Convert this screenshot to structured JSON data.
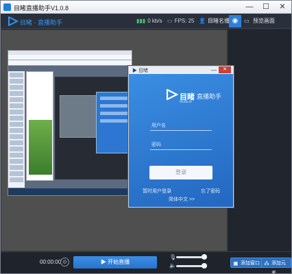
{
  "window": {
    "title": "目睹直播助手V1.0.8",
    "controls": {
      "minimize": "—",
      "maximize": "☐",
      "close": "✕"
    }
  },
  "header": {
    "brand": "目睹 · 直播助手",
    "stats": [
      {
        "icon": "signal-icon",
        "symbol": "▮▮▮",
        "value": "0 kb/s"
      },
      {
        "icon": "fps-icon",
        "symbol": "▭",
        "value": "FPS: 25"
      }
    ],
    "user_label": "目睹名播",
    "preview_label": "预览画面"
  },
  "login_dialog": {
    "mini_title": "▶ 目睹",
    "brand": "目睹",
    "brand_sub": "直播助手",
    "url": "mudu.tv",
    "username_placeholder": "用户名",
    "password_placeholder": "密码",
    "login_button": "登录",
    "register_link": "暂时用户登录",
    "forgot_link": "忘了密码",
    "language_link": "简体中文 >>"
  },
  "footer": {
    "timer": "00:00:00",
    "start_label": "开始直播",
    "add_window_label": "添加窗口",
    "add_source_label": "添加元素",
    "mic_level": 0.9,
    "speaker_level": 0.9
  },
  "colors": {
    "accent": "#2d80d8",
    "background": "#262b34",
    "preview": "#4f4f4f"
  }
}
